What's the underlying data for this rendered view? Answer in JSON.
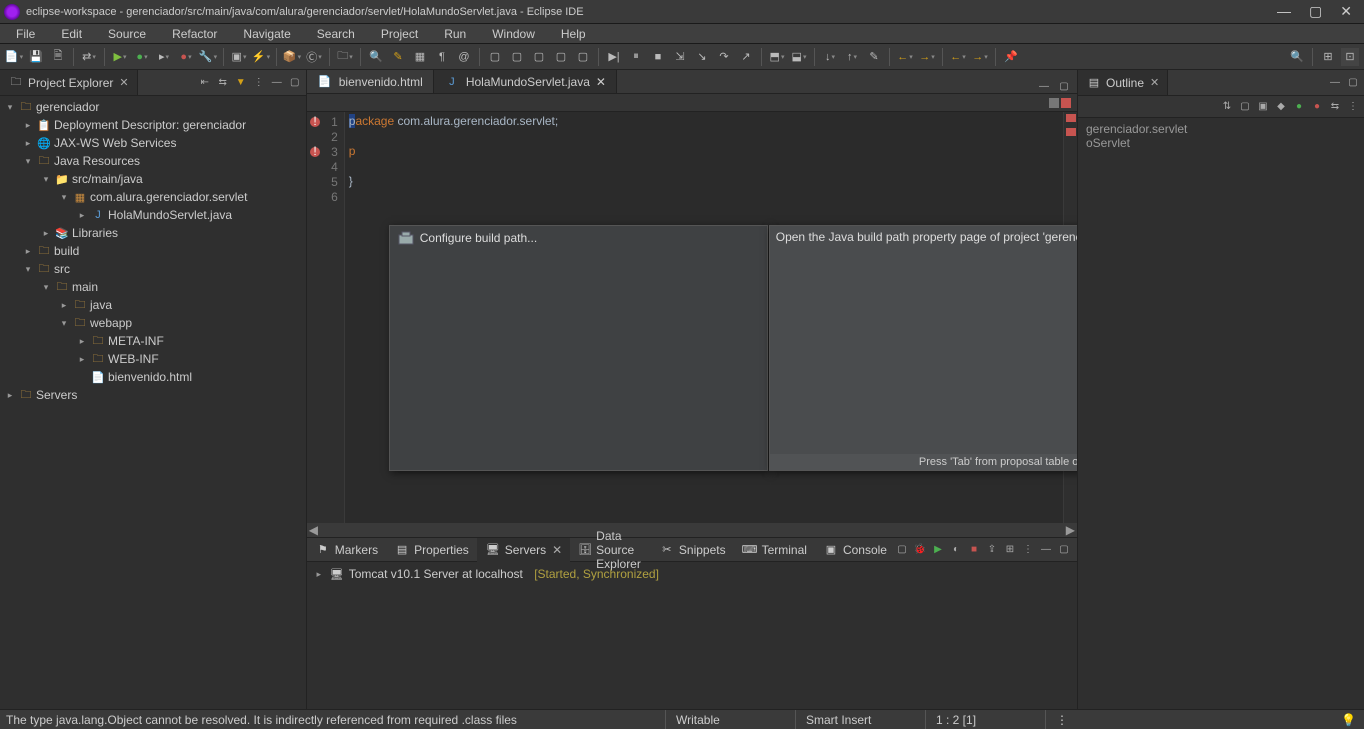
{
  "window": {
    "title": "eclipse-workspace - gerenciador/src/main/java/com/alura/gerenciador/servlet/HolaMundoServlet.java - Eclipse IDE"
  },
  "menu": [
    "File",
    "Edit",
    "Source",
    "Refactor",
    "Navigate",
    "Search",
    "Project",
    "Run",
    "Window",
    "Help"
  ],
  "project_explorer": {
    "title": "Project Explorer",
    "nodes": {
      "root": "gerenciador",
      "deploy": "Deployment Descriptor: gerenciador",
      "jaxws": "JAX-WS Web Services",
      "javares": "Java Resources",
      "srcmainjava": "src/main/java",
      "package": "com.alura.gerenciador.servlet",
      "javafile": "HolaMundoServlet.java",
      "libraries": "Libraries",
      "build": "build",
      "src": "src",
      "main": "main",
      "java": "java",
      "webapp": "webapp",
      "metainf": "META-INF",
      "webinf": "WEB-INF",
      "bienvenido": "bienvenido.html",
      "servers": "Servers"
    }
  },
  "editor": {
    "tabs": [
      {
        "label": "bienvenido.html",
        "active": false
      },
      {
        "label": "HolaMundoServlet.java",
        "active": true
      }
    ],
    "linenums": [
      "1",
      "2",
      "3",
      "4",
      "5",
      "6"
    ],
    "code_package_kw": "package",
    "code_package_name": " com.alura.gerenciador.servlet;",
    "code_brace": "}",
    "p_char": "p",
    "cursor_char": "p"
  },
  "popup": {
    "item_label": "Configure build path...",
    "description": "Open the Java build path property page of project 'gerenciador'",
    "footer": "Press 'Tab' from proposal table or click for focus"
  },
  "outline": {
    "title": "Outline",
    "pkg_text": "gerenciador.servlet",
    "class_text": "oServlet"
  },
  "bottom": {
    "tabs": [
      {
        "label": "Markers",
        "icon": "markers"
      },
      {
        "label": "Properties",
        "icon": "properties"
      },
      {
        "label": "Servers",
        "icon": "servers",
        "active": true
      },
      {
        "label": "Data Source Explorer",
        "icon": "datasource"
      },
      {
        "label": "Snippets",
        "icon": "snippets"
      },
      {
        "label": "Terminal",
        "icon": "terminal"
      },
      {
        "label": "Console",
        "icon": "console"
      }
    ],
    "server_name": "Tomcat v10.1 Server at localhost",
    "server_status": "[Started, Synchronized]"
  },
  "status": {
    "error": "The type java.lang.Object cannot be resolved. It is indirectly referenced from required .class files",
    "writable": "Writable",
    "insert": "Smart Insert",
    "pos": "1 : 2 [1]"
  }
}
